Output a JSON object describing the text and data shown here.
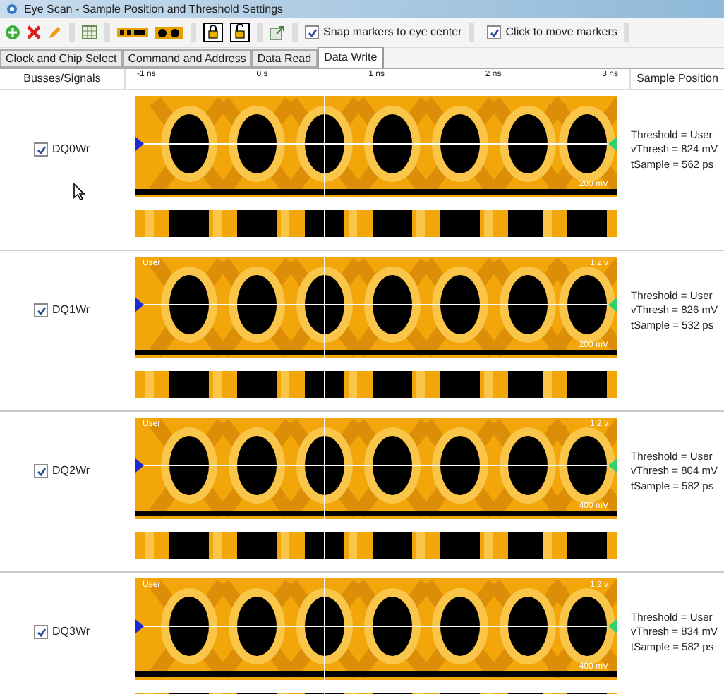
{
  "window": {
    "title": "Eye Scan - Sample Position and Threshold Settings"
  },
  "toolbar": {
    "checkboxes": [
      {
        "label": "Snap markers to eye center",
        "checked": true
      },
      {
        "label": "Click to move markers",
        "checked": true
      }
    ]
  },
  "tabs": [
    {
      "label": "Clock and Chip Select",
      "selected": false
    },
    {
      "label": "Command and Address",
      "selected": false
    },
    {
      "label": "Data Read",
      "selected": false
    },
    {
      "label": "Data Write",
      "selected": true
    }
  ],
  "columns": {
    "signals": "Busses/Signals",
    "sample_position": "Sample Position"
  },
  "time_axis": {
    "ticks": [
      "-1 ns",
      "0 s",
      "1 ns",
      "2 ns",
      "3 ns"
    ]
  },
  "signals": [
    {
      "name": "DQ0Wr",
      "checked": true,
      "plot_labels": {
        "bottom_right": "200 mV"
      },
      "threshold": "Threshold = User",
      "vthresh": "vThresh = 824 mV",
      "tsample": "tSample = 562 ps"
    },
    {
      "name": "DQ1Wr",
      "checked": true,
      "plot_labels": {
        "top_left": "User",
        "top_right": "1.2 v",
        "bottom_right": "200 mV"
      },
      "threshold": "Threshold = User",
      "vthresh": "vThresh = 826 mV",
      "tsample": "tSample = 532 ps"
    },
    {
      "name": "DQ2Wr",
      "checked": true,
      "plot_labels": {
        "top_left": "User",
        "top_right": "1.2 v",
        "bottom_right": "400 mV"
      },
      "threshold": "Threshold = User",
      "vthresh": "vThresh = 804 mV",
      "tsample": "tSample = 582 ps"
    },
    {
      "name": "DQ3Wr",
      "checked": true,
      "plot_labels": {
        "top_left": "User",
        "top_right": "1.2 v",
        "bottom_right": "400 mV"
      },
      "threshold": "Threshold = User",
      "vthresh": "vThresh = 834 mV",
      "tsample": "tSample = 582 ps"
    }
  ]
}
